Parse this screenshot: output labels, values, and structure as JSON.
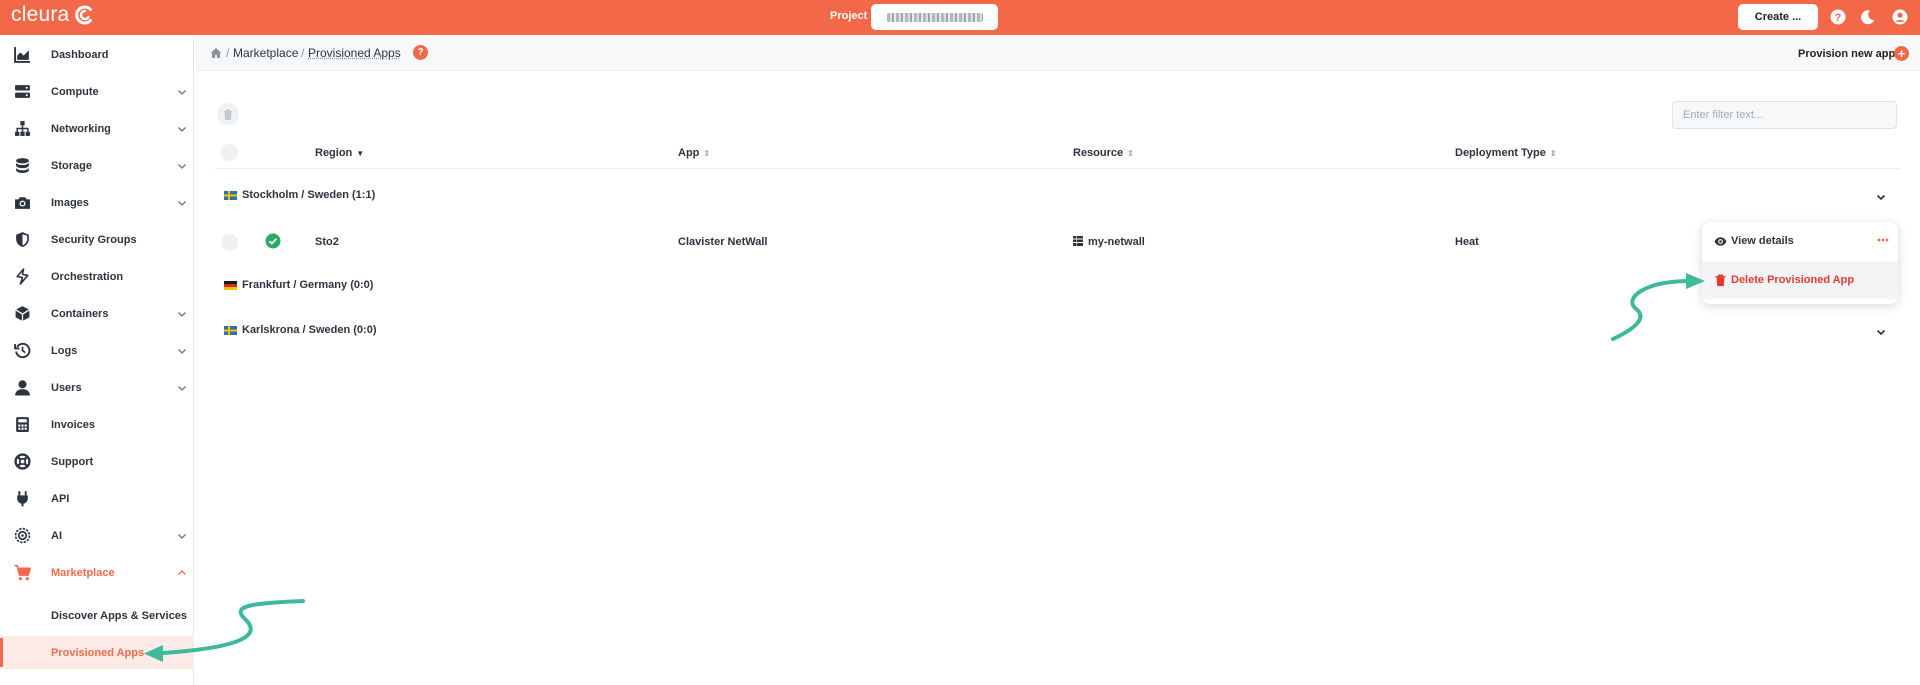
{
  "topbar": {
    "logo_text": "cleura",
    "project_label": "Project",
    "create_label": "Create ...",
    "brand_color": "#f4684a"
  },
  "sidebar": {
    "items": [
      {
        "label": "Dashboard",
        "icon": "chart-area-icon",
        "expandable": false
      },
      {
        "label": "Compute",
        "icon": "server-icon",
        "expandable": true
      },
      {
        "label": "Networking",
        "icon": "network-icon",
        "expandable": true
      },
      {
        "label": "Storage",
        "icon": "database-icon",
        "expandable": true
      },
      {
        "label": "Images",
        "icon": "camera-icon",
        "expandable": true
      },
      {
        "label": "Security Groups",
        "icon": "shield-icon",
        "expandable": false
      },
      {
        "label": "Orchestration",
        "icon": "orchestration-icon",
        "expandable": false
      },
      {
        "label": "Containers",
        "icon": "cube-icon",
        "expandable": true
      },
      {
        "label": "Logs",
        "icon": "history-icon",
        "expandable": true
      },
      {
        "label": "Users",
        "icon": "user-icon",
        "expandable": true
      },
      {
        "label": "Invoices",
        "icon": "calculator-icon",
        "expandable": false
      },
      {
        "label": "Support",
        "icon": "life-ring-icon",
        "expandable": false
      },
      {
        "label": "API",
        "icon": "plug-icon",
        "expandable": false
      },
      {
        "label": "AI",
        "icon": "ai-icon",
        "expandable": true
      },
      {
        "label": "Marketplace",
        "icon": "cart-icon",
        "expandable": true,
        "expanded": true,
        "active": true
      }
    ],
    "marketplace_sub": [
      {
        "label": "Discover Apps & Services"
      },
      {
        "label": "Provisioned Apps",
        "current": true
      }
    ]
  },
  "breadcrumb": {
    "items": [
      "Marketplace",
      "Provisioned Apps"
    ],
    "help": "?"
  },
  "header_actions": {
    "provision_label": "Provision new app",
    "plus": "+"
  },
  "table": {
    "filter_placeholder": "Enter filter text...",
    "columns": {
      "region": "Region",
      "app": "App",
      "resource": "Resource",
      "deployment_type": "Deployment Type"
    },
    "groups": [
      {
        "label": "Stockholm / Sweden (1:1)",
        "flag": "sweden",
        "expandable": true
      },
      {
        "label": "Frankfurt / Germany (0:0)",
        "flag": "germany",
        "expandable": false
      },
      {
        "label": "Karlskrona / Sweden (0:0)",
        "flag": "sweden",
        "expandable": true
      }
    ],
    "rows": [
      {
        "region": "Sto2",
        "app": "Clavister NetWall",
        "resource": "my-netwall",
        "deployment_type": "Heat",
        "status": "ok"
      }
    ]
  },
  "context_menu": {
    "view_label": "View details",
    "delete_label": "Delete Provisioned App",
    "danger_color": "#e5382e"
  },
  "annotation_color": "#3dba9c"
}
